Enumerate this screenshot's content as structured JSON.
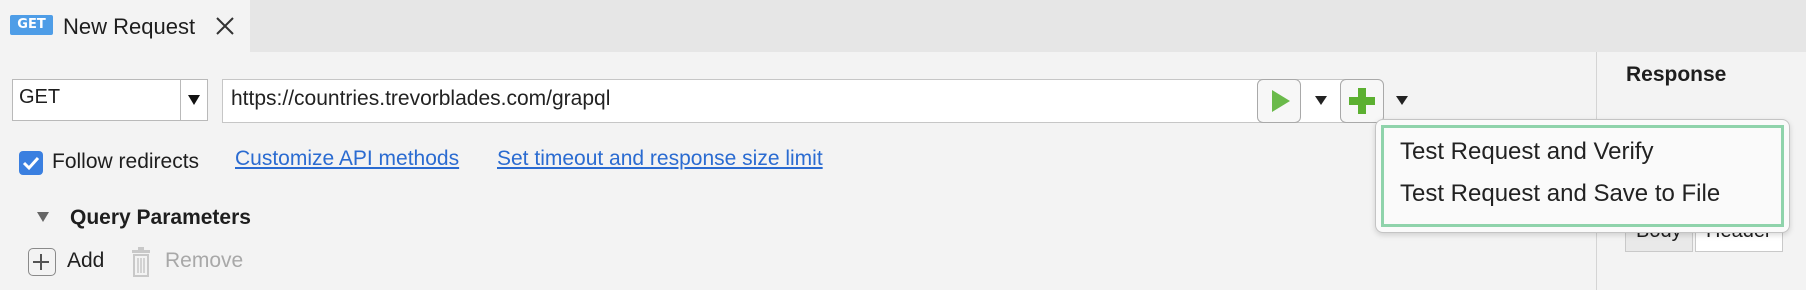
{
  "tab": {
    "method_badge": "GET",
    "title": "New Request"
  },
  "request": {
    "method": "GET",
    "url": "https://countries.trevorblades.com/grapql"
  },
  "options": {
    "follow_redirects_label": "Follow redirects",
    "follow_redirects_checked": true,
    "customize_link": "Customize API methods",
    "timeout_link": "Set timeout and response size limit"
  },
  "query_params": {
    "title": "Query Parameters",
    "add_label": "Add",
    "remove_label": "Remove"
  },
  "run_menu": {
    "items": [
      "Test Request and Verify",
      "Test Request and Save to File"
    ]
  },
  "response": {
    "title": "Response",
    "tabs": [
      "Body",
      "Header"
    ]
  },
  "colors": {
    "accent_blue": "#3a7fe0",
    "link_blue": "#2a6bd1",
    "run_green": "#6aba4a",
    "menu_highlight": "#8fd3ab"
  }
}
